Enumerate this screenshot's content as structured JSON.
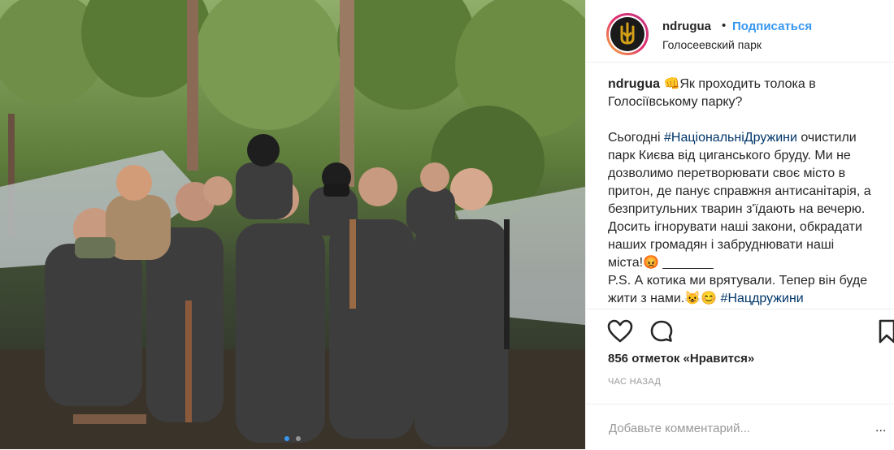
{
  "post": {
    "photo_alt": "group photo in the forest",
    "carousel": {
      "count": 2,
      "active": 1
    }
  },
  "header": {
    "username": "ndrugua",
    "separator": "•",
    "follow_label": "Подписаться",
    "location": "Голосеевский парк"
  },
  "caption": {
    "username": "ndrugua",
    "line1": "👊Як проходить толока в Голосіївському парку?",
    "p2_before": "Сьогодні ",
    "p2_tag": "#НаціональніДружини",
    "p2_after": " очистили парк Києва від циганського бруду. Ми не дозволимо перетворювати своє місто в притон, де панує справжня антисанітарія, а безпритульних тварин з'їдають на вечерю. Досить ігнорувати наші закони, обкрадати наших громадян і забруднювати наші міста!😡  _______",
    "p3_text": "P.S. А котика ми врятували. Тепер він буде жити з нами.😺😊 ",
    "p3_tag": "#Нацдружини"
  },
  "actions": {
    "like_icon": "heart-icon",
    "comment_icon": "comment-icon",
    "save_icon": "bookmark-icon"
  },
  "likes": "856 отметок «Нравится»",
  "time": "час назад",
  "comment": {
    "placeholder": "Добавьте комментарий...",
    "more": "..."
  },
  "colors": {
    "accent": "#3897f0",
    "text": "#262626",
    "muted": "#999999",
    "hashtag": "#003569"
  }
}
